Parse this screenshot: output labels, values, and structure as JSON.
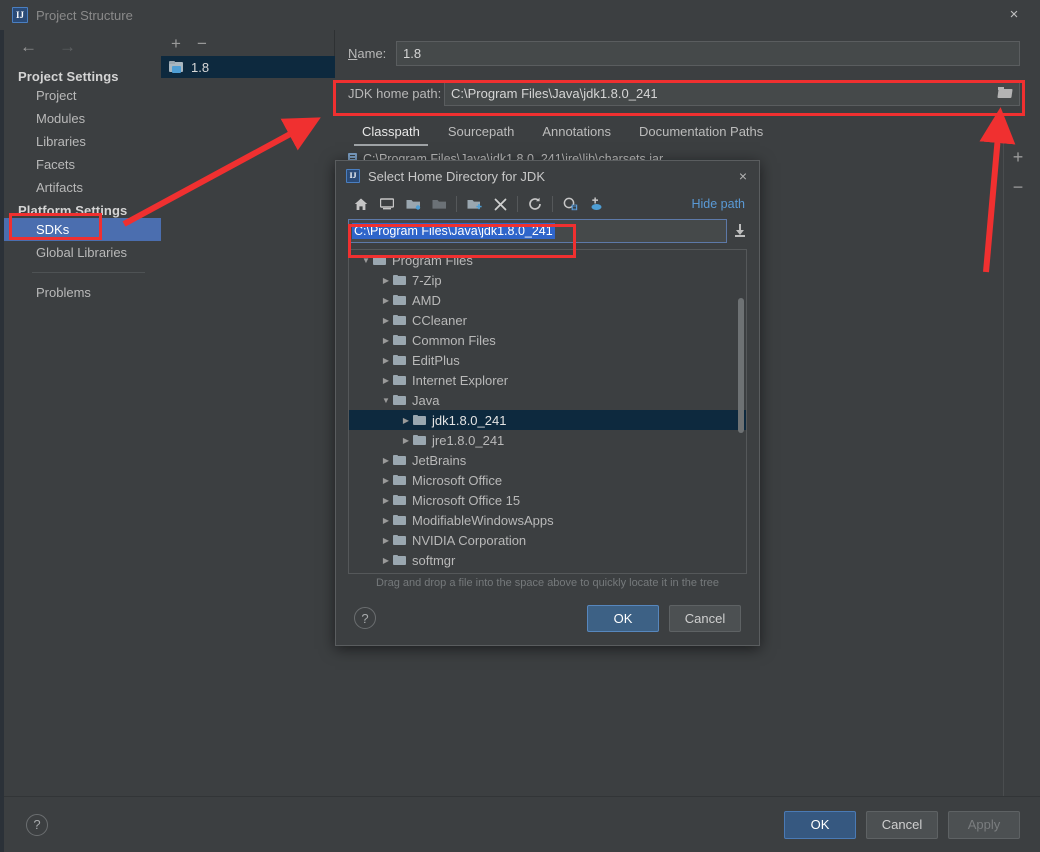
{
  "window": {
    "title": "Project Structure",
    "app_icon": "IJ",
    "close_icon": "×"
  },
  "sidebar": {
    "back_icon": "←",
    "forward_icon": "→",
    "project_settings_title": "Project Settings",
    "project_items": [
      {
        "label": "Project"
      },
      {
        "label": "Modules"
      },
      {
        "label": "Libraries"
      },
      {
        "label": "Facets"
      },
      {
        "label": "Artifacts"
      }
    ],
    "platform_settings_title": "Platform Settings",
    "platform_items": [
      {
        "label": "SDKs",
        "selected": true
      },
      {
        "label": "Global Libraries",
        "selected": false
      }
    ],
    "problems_label": "Problems"
  },
  "sdk_panel": {
    "add_icon": "+",
    "remove_icon": "−",
    "items": [
      {
        "label": "1.8",
        "selected": true
      }
    ]
  },
  "detail": {
    "name_label": "Name:",
    "name_value": "1.8",
    "jdk_home_label": "JDK home path:",
    "jdk_home_value": "C:\\Program Files\\Java\\jdk1.8.0_241",
    "browse_icon": "folder-open-icon",
    "tabs": [
      {
        "label": "Classpath",
        "active": true
      },
      {
        "label": "Sourcepath",
        "active": false
      },
      {
        "label": "Annotations",
        "active": false
      },
      {
        "label": "Documentation Paths",
        "active": false
      }
    ],
    "classpath_entries": [
      {
        "path": "C:\\Program Files\\Java\\jdk1.8.0_241\\jre\\lib\\charsets.jar"
      }
    ],
    "add_icon": "+",
    "remove_icon": "−"
  },
  "footer": {
    "help_icon": "?",
    "ok_label": "OK",
    "cancel_label": "Cancel",
    "apply_label": "Apply"
  },
  "modal": {
    "title": "Select Home Directory for JDK",
    "app_icon": "IJ",
    "close_icon": "×",
    "toolbar": [
      {
        "name": "home-icon"
      },
      {
        "name": "desktop-icon"
      },
      {
        "name": "project-folder-icon"
      },
      {
        "name": "module-folder-icon"
      },
      {
        "name": "new-folder-icon"
      },
      {
        "name": "delete-icon"
      },
      {
        "name": "refresh-icon"
      },
      {
        "name": "show-hidden-icon"
      },
      {
        "name": "add-bookmark-icon"
      }
    ],
    "hide_path_label": "Hide path",
    "path_value": "C:\\Program Files\\Java\\jdk1.8.0_241",
    "path_download_icon": "download-icon",
    "tree": [
      {
        "label": "Program Files",
        "depth": 0,
        "expanded": true,
        "selected": false
      },
      {
        "label": "7-Zip",
        "depth": 1,
        "expanded": false,
        "selected": false
      },
      {
        "label": "AMD",
        "depth": 1,
        "expanded": false,
        "selected": false
      },
      {
        "label": "CCleaner",
        "depth": 1,
        "expanded": false,
        "selected": false
      },
      {
        "label": "Common Files",
        "depth": 1,
        "expanded": false,
        "selected": false
      },
      {
        "label": "EditPlus",
        "depth": 1,
        "expanded": false,
        "selected": false
      },
      {
        "label": "Internet Explorer",
        "depth": 1,
        "expanded": false,
        "selected": false
      },
      {
        "label": "Java",
        "depth": 1,
        "expanded": true,
        "selected": false
      },
      {
        "label": "jdk1.8.0_241",
        "depth": 2,
        "expanded": false,
        "selected": true
      },
      {
        "label": "jre1.8.0_241",
        "depth": 2,
        "expanded": false,
        "selected": false
      },
      {
        "label": "JetBrains",
        "depth": 1,
        "expanded": false,
        "selected": false
      },
      {
        "label": "Microsoft Office",
        "depth": 1,
        "expanded": false,
        "selected": false
      },
      {
        "label": "Microsoft Office 15",
        "depth": 1,
        "expanded": false,
        "selected": false
      },
      {
        "label": "ModifiableWindowsApps",
        "depth": 1,
        "expanded": false,
        "selected": false
      },
      {
        "label": "NVIDIA Corporation",
        "depth": 1,
        "expanded": false,
        "selected": false
      },
      {
        "label": "softmgr",
        "depth": 1,
        "expanded": false,
        "selected": false
      }
    ],
    "hint": "Drag and drop a file into the space above to quickly locate it in the tree",
    "help_icon": "?",
    "ok_label": "OK",
    "cancel_label": "Cancel"
  },
  "annotations": {
    "highlight_color": "#f03030",
    "boxes": [
      {
        "name": "sdks-highlight"
      },
      {
        "name": "jdk-home-path-highlight"
      },
      {
        "name": "modal-path-highlight"
      }
    ],
    "arrows": [
      {
        "name": "arrow-sdks-to-sdk-list"
      },
      {
        "name": "arrow-to-jdk-home-path"
      }
    ]
  },
  "colors": {
    "background": "#3c3f41",
    "selection_blue": "#4b6eaf",
    "tree_selection": "#0d293e",
    "accent_link": "#5a9ad6",
    "primary_button": "#365880",
    "text_selection": "#2f65ca"
  }
}
